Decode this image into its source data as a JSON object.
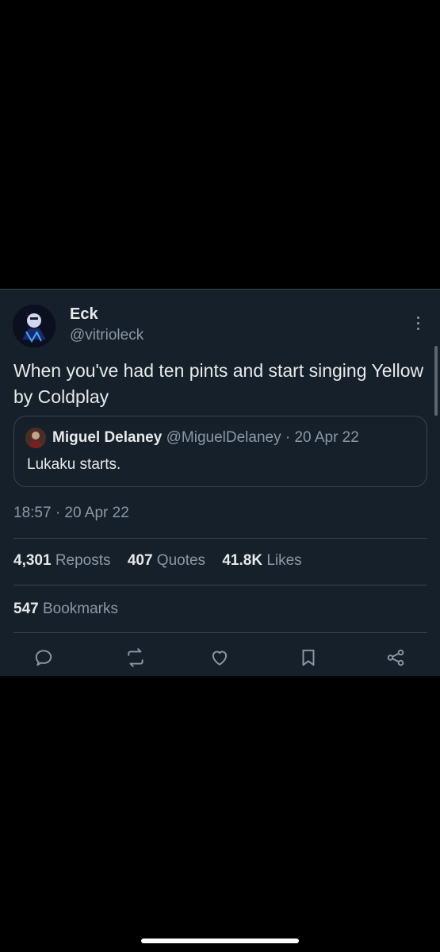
{
  "tweet": {
    "author": {
      "name": "Eck",
      "handle": "@vitrioleck"
    },
    "text": "When you've had ten pints and start singing Yellow by Coldplay",
    "timestamp": "18:57 · 20 Apr 22",
    "quoted": {
      "name": "Miguel Delaney",
      "handle": "@MiguelDelaney · 20 Apr 22",
      "text": "Lukaku starts."
    },
    "stats": {
      "reposts_count": "4,301",
      "reposts_label": "Reposts",
      "quotes_count": "407",
      "quotes_label": "Quotes",
      "likes_count": "41.8K",
      "likes_label": "Likes",
      "bookmarks_count": "547",
      "bookmarks_label": "Bookmarks"
    },
    "actions": [
      "reply-icon",
      "repost-icon",
      "like-icon",
      "bookmark-icon",
      "share-icon"
    ]
  },
  "colors": {
    "page_background": "#000000",
    "card_background": "#15202b",
    "primary_text": "#e7e9ea",
    "secondary_text": "#8b98a5",
    "border": "#38444d"
  }
}
